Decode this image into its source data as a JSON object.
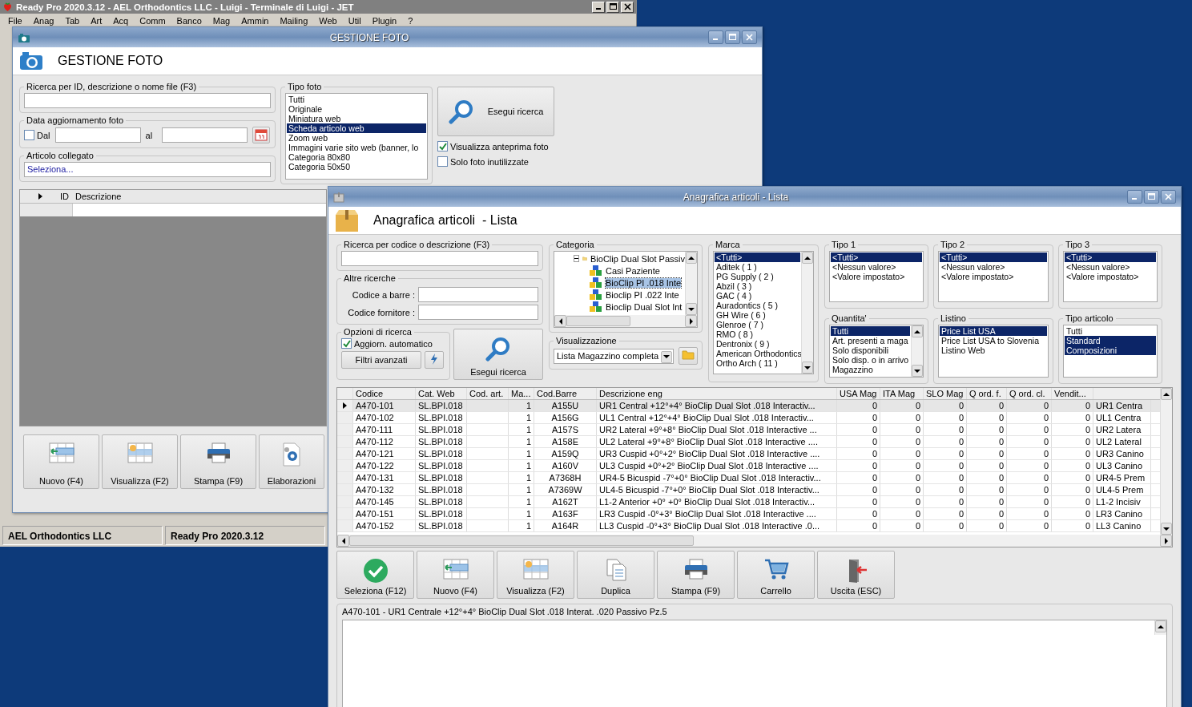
{
  "main_window": {
    "title": "Ready Pro 2020.3.12 - AEL Orthodontics LLC - Luigi - Terminale di Luigi - JET",
    "menu": [
      "File",
      "Anag",
      "Tab",
      "Art",
      "Acq",
      "Comm",
      "Banco",
      "Mag",
      "Ammin",
      "Mailing",
      "Web",
      "Util",
      "Plugin",
      "?"
    ],
    "status_bar": [
      "AEL Orthodontics LLC",
      "Ready Pro 2020.3.12"
    ]
  },
  "photo_window": {
    "title": "GESTIONE FOTO",
    "heading": "GESTIONE FOTO",
    "search": {
      "label": "Ricerca per ID, descrizione o nome file (F3)"
    },
    "date_group": {
      "label": "Data aggiornamento foto",
      "from_label": "Dal",
      "from_checked": false,
      "to_label": "al"
    },
    "linked_article": {
      "label": "Articolo collegato",
      "value": "Seleziona..."
    },
    "photo_type": {
      "label": "Tipo foto",
      "items": [
        {
          "label": "Tutti",
          "selected": false
        },
        {
          "label": "Originale",
          "selected": false
        },
        {
          "label": "Miniatura web",
          "selected": false
        },
        {
          "label": "Scheda articolo web",
          "selected": true
        },
        {
          "label": "Zoom web",
          "selected": false
        },
        {
          "label": "Immagini varie sito web (banner, lo",
          "selected": false
        },
        {
          "label": "Categoria 80x80",
          "selected": false
        },
        {
          "label": "Categoria 50x50",
          "selected": false
        }
      ]
    },
    "search_button": "Esegui ricerca",
    "options": [
      {
        "label": "Visualizza anteprima foto",
        "checked": true
      },
      {
        "label": "Solo foto inutilizzate",
        "checked": false
      }
    ],
    "grid": {
      "columns": [
        "ID",
        "Descrizione"
      ]
    },
    "buttons": [
      {
        "label": "Nuovo (F4)",
        "kind": "new"
      },
      {
        "label": "Visualizza (F2)",
        "kind": "view"
      },
      {
        "label": "Stampa (F9)",
        "kind": "print"
      },
      {
        "label": "Elaborazioni",
        "kind": "process"
      }
    ]
  },
  "articles_window": {
    "title": "Anagrafica articoli - Lista",
    "heading": "Anagrafica articoli  - Lista",
    "search": {
      "label": "Ricerca per codice o descrizione (F3)"
    },
    "other_searches": {
      "label": "Altre ricerche",
      "fields": [
        "Codice a barre :",
        "Codice fornitore :"
      ]
    },
    "search_options": {
      "label": "Opzioni di ricerca",
      "auto_update": {
        "label": "Aggiorn. automatico",
        "checked": true
      },
      "advanced_button": "Filtri avanzati"
    },
    "search_button": "Esegui ricerca",
    "category": {
      "label": "Categoria",
      "tree": [
        {
          "label": "BioClip Dual Slot Passiv",
          "expanded": true,
          "children": [
            {
              "label": "Casi Paziente",
              "selected": false
            },
            {
              "label": "BioClip PI .018 Inte",
              "selected": true
            },
            {
              "label": "Bioclip PI  .022 Inte",
              "selected": false
            },
            {
              "label": "Bioclip Dual Slot Int",
              "selected": false
            }
          ]
        }
      ]
    },
    "view": {
      "label": "Visualizzazione",
      "value": "Lista Magazzino completa"
    },
    "lists": [
      {
        "label": "Marca",
        "scroll": true,
        "items": [
          {
            "label": "<Tutti>",
            "selected": true
          },
          {
            "label": "Aditek ( 1 )",
            "selected": false
          },
          {
            "label": "PG Supply ( 2 )",
            "selected": false
          },
          {
            "label": "Abzil ( 3 )",
            "selected": false
          },
          {
            "label": "GAC ( 4 )",
            "selected": false
          },
          {
            "label": "Auradontics ( 5 )",
            "selected": false
          },
          {
            "label": "GH Wire ( 6 )",
            "selected": false
          },
          {
            "label": "Glenroe ( 7 )",
            "selected": false
          },
          {
            "label": "RMO ( 8 )",
            "selected": false
          },
          {
            "label": "Dentronix ( 9 )",
            "selected": false
          },
          {
            "label": "American Orthodontics",
            "selected": false
          },
          {
            "label": "Ortho Arch ( 11 )",
            "selected": false
          }
        ]
      },
      {
        "label": "Tipo 1",
        "scroll": false,
        "items": [
          {
            "label": "<Tutti>",
            "selected": true
          },
          {
            "label": "<Nessun valore>",
            "selected": false
          },
          {
            "label": "<Valore impostato>",
            "selected": false
          }
        ]
      },
      {
        "label": "Tipo 2",
        "scroll": false,
        "items": [
          {
            "label": "<Tutti>",
            "selected": true
          },
          {
            "label": "<Nessun valore>",
            "selected": false
          },
          {
            "label": "<Valore impostato>",
            "selected": false
          }
        ]
      },
      {
        "label": "Tipo 3",
        "scroll": false,
        "items": [
          {
            "label": "<Tutti>",
            "selected": true
          },
          {
            "label": "<Nessun valore>",
            "selected": false
          },
          {
            "label": "<Valore impostato>",
            "selected": false
          }
        ]
      },
      {
        "label": "Quantita'",
        "scroll": true,
        "items": [
          {
            "label": "Tutti",
            "selected": true
          },
          {
            "label": "Art. presenti a maga",
            "selected": false
          },
          {
            "label": "Solo disponibili",
            "selected": false
          },
          {
            "label": "Solo disp. o in arrivo",
            "selected": false
          },
          {
            "label": "Magazzino",
            "selected": false
          }
        ]
      },
      {
        "label": "Listino",
        "scroll": false,
        "items": [
          {
            "label": "Price List USA",
            "selected": true
          },
          {
            "label": "Price List USA to Slovenia",
            "selected": false
          },
          {
            "label": "Listino Web",
            "selected": false
          }
        ]
      },
      {
        "label": "Tipo articolo",
        "scroll": false,
        "items": [
          {
            "label": "Tutti",
            "selected": false
          },
          {
            "label": "Standard",
            "selected": true
          },
          {
            "label": "Composizioni",
            "selected": true
          }
        ]
      }
    ],
    "table": {
      "columns": [
        "Codice",
        "Cat. Web",
        "Cod. art.",
        "Ma...",
        "Cod.Barre",
        "Descrizione eng",
        "USA Mag",
        "ITA Mag",
        "SLO Mag",
        "Q ord. f.",
        "Q ord. cl.",
        "Vendit..."
      ],
      "rows": [
        {
          "selected": true,
          "cells": [
            "A470-101",
            "SL.BPI.018",
            "",
            "1",
            "A155U",
            "UR1 Central +12°+4° BioClip Dual Slot .018 Interactiv...",
            "0",
            "0",
            "0",
            "0",
            "0",
            "0",
            "UR1 Centra"
          ]
        },
        {
          "selected": false,
          "cells": [
            "A470-102",
            "SL.BPI.018",
            "",
            "1",
            "A156G",
            "UL1 Central +12°+4° BioClip Dual Slot .018 Interactiv...",
            "0",
            "0",
            "0",
            "0",
            "0",
            "0",
            "UL1 Centra"
          ]
        },
        {
          "selected": false,
          "cells": [
            "A470-111",
            "SL.BPI.018",
            "",
            "1",
            "A157S",
            "UR2 Lateral +9°+8° BioClip Dual Slot .018 Interactive ...",
            "0",
            "0",
            "0",
            "0",
            "0",
            "0",
            "UR2 Latera"
          ]
        },
        {
          "selected": false,
          "cells": [
            "A470-112",
            "SL.BPI.018",
            "",
            "1",
            "A158E",
            "UL2 Lateral +9°+8° BioClip Dual Slot .018 Interactive ....",
            "0",
            "0",
            "0",
            "0",
            "0",
            "0",
            "UL2 Lateral"
          ]
        },
        {
          "selected": false,
          "cells": [
            "A470-121",
            "SL.BPI.018",
            "",
            "1",
            "A159Q",
            "UR3 Cuspid +0°+2° BioClip Dual Slot .018 Interactive ....",
            "0",
            "0",
            "0",
            "0",
            "0",
            "0",
            "UR3 Canino"
          ]
        },
        {
          "selected": false,
          "cells": [
            "A470-122",
            "SL.BPI.018",
            "",
            "1",
            "A160V",
            "UL3 Cuspid +0°+2° BioClip Dual Slot .018 Interactive ....",
            "0",
            "0",
            "0",
            "0",
            "0",
            "0",
            "UL3 Canino"
          ]
        },
        {
          "selected": false,
          "cells": [
            "A470-131",
            "SL.BPI.018",
            "",
            "1",
            "A7368H",
            "UR4-5 Bicuspid -7°+0° BioClip Dual Slot .018 Interactiv...",
            "0",
            "0",
            "0",
            "0",
            "0",
            "0",
            "UR4-5 Prem"
          ]
        },
        {
          "selected": false,
          "cells": [
            "A470-132",
            "SL.BPI.018",
            "",
            "1",
            "A7369W",
            "UL4-5 Bicuspid -7°+0° BioClip Dual Slot .018 Interactiv...",
            "0",
            "0",
            "0",
            "0",
            "0",
            "0",
            "UL4-5 Prem"
          ]
        },
        {
          "selected": false,
          "cells": [
            "A470-145",
            "SL.BPI.018",
            "",
            "1",
            "A162T",
            "L1-2 Anterior +0° +0° BioClip Dual Slot .018 Interactiv...",
            "0",
            "0",
            "0",
            "0",
            "0",
            "0",
            "L1-2 Incisiv"
          ]
        },
        {
          "selected": false,
          "cells": [
            "A470-151",
            "SL.BPI.018",
            "",
            "1",
            "A163F",
            "LR3 Cuspid -0°+3° BioClip Dual Slot .018 Interactive ....",
            "0",
            "0",
            "0",
            "0",
            "0",
            "0",
            "LR3 Canino"
          ]
        },
        {
          "selected": false,
          "cells": [
            "A470-152",
            "SL.BPI.018",
            "",
            "1",
            "A164R",
            "LL3 Cuspid -0°+3° BioClip Dual Slot .018 Interactive .0...",
            "0",
            "0",
            "0",
            "0",
            "0",
            "0",
            "LL3 Canino"
          ]
        }
      ]
    },
    "buttons": [
      {
        "label": "Seleziona (F12)",
        "kind": "select"
      },
      {
        "label": "Nuovo (F4)",
        "kind": "new"
      },
      {
        "label": "Visualizza (F2)",
        "kind": "view"
      },
      {
        "label": "Duplica",
        "kind": "duplicate"
      },
      {
        "label": "Stampa (F9)",
        "kind": "print"
      },
      {
        "label": "Carrello",
        "kind": "cart"
      },
      {
        "label": "Uscita (ESC)",
        "kind": "exit"
      }
    ],
    "detail": "A470-101 - UR1 Centrale +12°+4° BioClip Dual Slot .018 Interat. .020 Passivo Pz.5"
  }
}
